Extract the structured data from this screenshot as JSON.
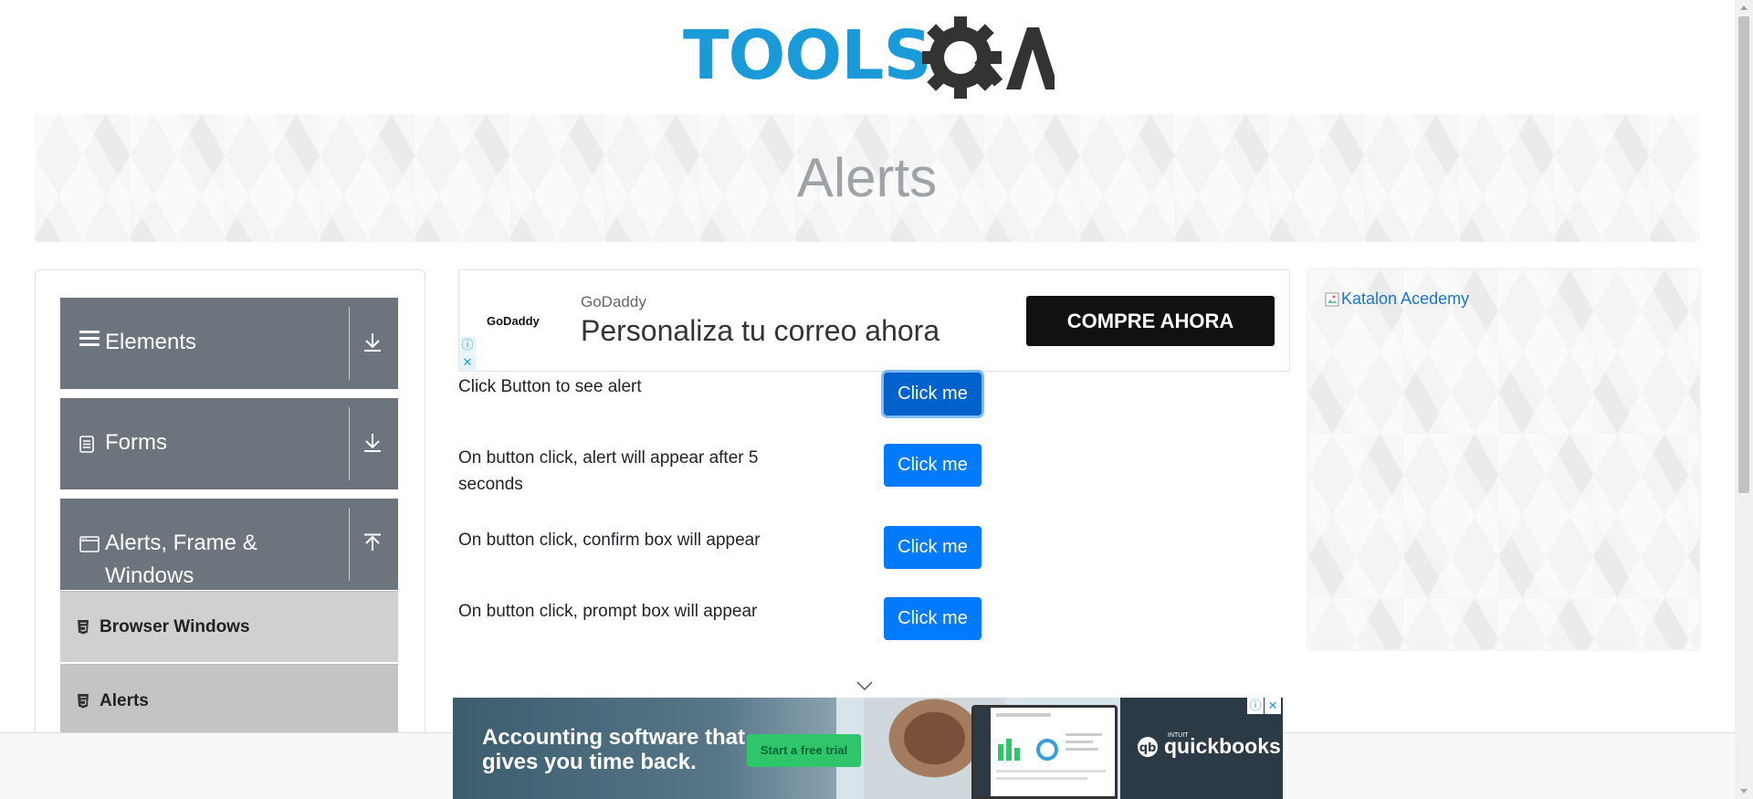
{
  "header": {
    "logo_text": "TOOLS",
    "logo_qa": "QA"
  },
  "banner": {
    "title": "Alerts"
  },
  "sidebar": {
    "groups": [
      {
        "label": "Elements",
        "icon": "hamburger-icon",
        "arrow": "download-arrow-icon"
      },
      {
        "label": "Forms",
        "icon": "document-icon",
        "arrow": "download-arrow-icon"
      },
      {
        "label_line1": "Alerts, Frame &",
        "label_line2": "Windows",
        "icon": "window-icon",
        "arrow": "upload-arrow-icon"
      }
    ],
    "items": [
      {
        "label": "Browser Windows",
        "icon": "html5-icon"
      },
      {
        "label": "Alerts",
        "icon": "html5-icon"
      }
    ]
  },
  "ad_top": {
    "logo": "GoDaddy",
    "brand": "GoDaddy",
    "headline": "Personaliza tu correo ahora",
    "cta": "COMPRE AHORA"
  },
  "alerts": {
    "rows": [
      {
        "text": "Click Button to see alert",
        "button": "Click me"
      },
      {
        "text": "On button click, alert will appear after 5 seconds",
        "button": "Click me"
      },
      {
        "text": "On button click, confirm box will appear",
        "button": "Click me"
      },
      {
        "text": "On button click, prompt box will appear",
        "button": "Click me"
      }
    ]
  },
  "right_ad": {
    "alt_text": "Katalon Acedemy"
  },
  "bottom_ad": {
    "headline": "Accounting software that gives you time back.",
    "cta": "Start a free trial",
    "brand": "quickbooks",
    "brand_small": "INTUIT"
  },
  "colors": {
    "primary_button": "#007bff",
    "sidebar_header": "#6c757d",
    "sidebar_item": "#d0d0d0",
    "logo_blue": "#1a9ad9"
  }
}
